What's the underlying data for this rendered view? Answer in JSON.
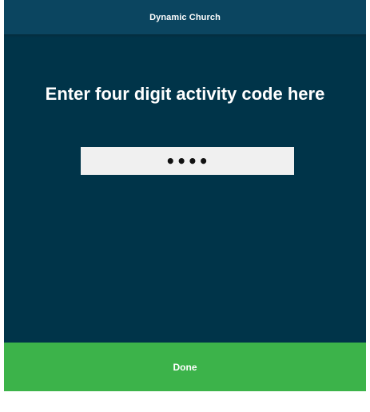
{
  "header": {
    "title": "Dynamic Church"
  },
  "main": {
    "prompt": "Enter four digit activity code here",
    "code_field": {
      "value": "••••",
      "masked": true
    }
  },
  "footer": {
    "done_label": "Done"
  },
  "colors": {
    "background": "#003449",
    "header": "#0b4560",
    "input_background": "#f0f0f0",
    "done_button": "#3cb34a"
  }
}
